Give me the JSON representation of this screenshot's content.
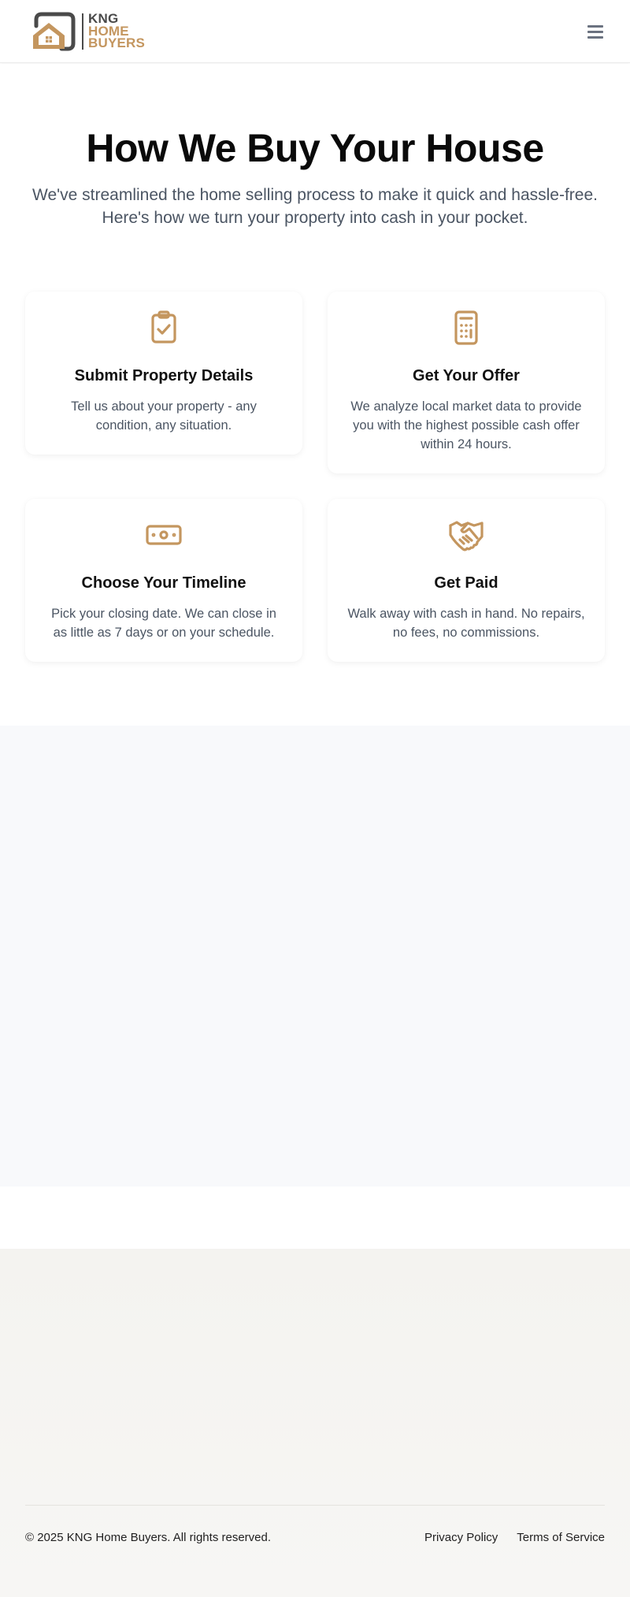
{
  "brand": {
    "line1": "KNG",
    "line2": "HOME",
    "line3": "BUYERS",
    "accent_color": "#c4965f",
    "dark_color": "#4a4a4a"
  },
  "header": {
    "menu_icon": "hamburger-menu-icon"
  },
  "steps_section": {
    "title": "How We Buy Your House",
    "subtitle": "We've streamlined the home selling process to make it quick and hassle-free. Here's how we turn your property into cash in your pocket.",
    "steps": [
      {
        "icon": "clipboard-check-icon",
        "title": "Submit Property Details",
        "text": "Tell us about your property - any condition, any situation."
      },
      {
        "icon": "calculator-icon",
        "title": "Get Your Offer",
        "text": "We analyze local market data to provide you with the highest possible cash offer within 24 hours."
      },
      {
        "icon": "banknote-icon",
        "title": "Choose Your Timeline",
        "text": "Pick your closing date. We can close in as little as 7 days or on your schedule."
      },
      {
        "icon": "handshake-icon",
        "title": "Get Paid",
        "text": "Walk away with cash in hand. No repairs, no fees, no commissions."
      }
    ]
  },
  "footer": {
    "copyright": "© 2025 KNG Home Buyers. All rights reserved.",
    "links": [
      "Privacy Policy",
      "Terms of Service"
    ]
  }
}
